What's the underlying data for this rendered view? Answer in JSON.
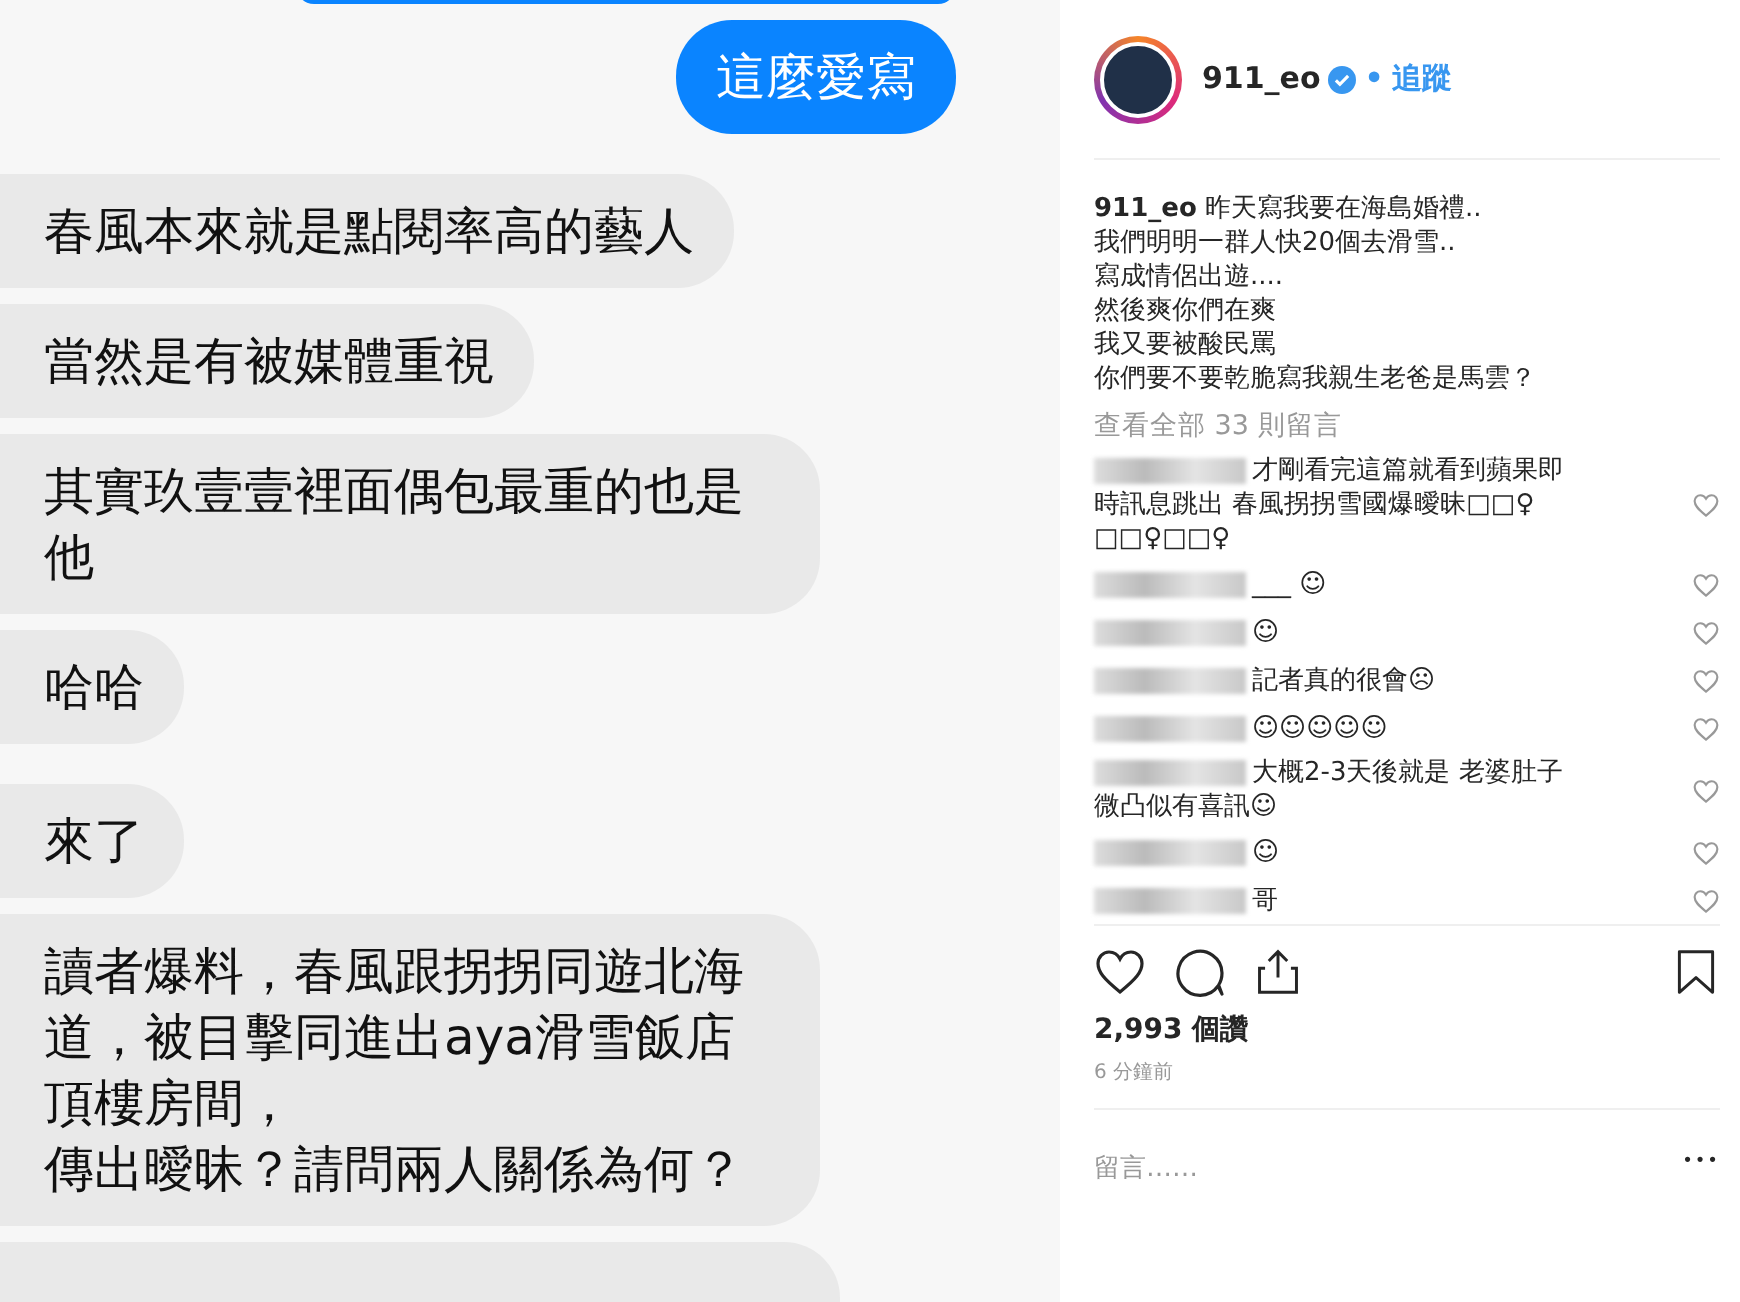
{
  "chat": {
    "messages": [
      {
        "kind": "sent",
        "text": "這麼愛寫"
      },
      {
        "kind": "received",
        "text": "春風本來就是點閱率高的藝人"
      },
      {
        "kind": "received",
        "text": "當然是有被媒體重視"
      },
      {
        "kind": "received",
        "text": "其實玖壹壹裡面偶包最重的也是他"
      },
      {
        "kind": "received",
        "text": "哈哈"
      },
      {
        "kind": "received",
        "text": "來了"
      },
      {
        "kind": "received",
        "text": "讀者爆料，春風跟拐拐同遊北海道，被目擊同進出aya滑雪飯店頂樓房間，",
        "text2": "傳出曖昧？請問兩人關係為何？"
      }
    ]
  },
  "post": {
    "username": "911_eo",
    "verified": true,
    "separator": "•",
    "follow": "追蹤",
    "caption_user": "911_eo",
    "caption": [
      "昨天寫我要在海島婚禮..",
      "我們明明一群人快20個去滑雪..",
      "寫成情侶出遊....",
      "然後爽你們在爽",
      "我又要被酸民罵",
      "你們要不要乾脆寫我親生老爸是馬雲？"
    ],
    "view_all": "查看全部 33 則留言",
    "comments": [
      {
        "text": "才剛看完這篇就看到蘋果即",
        "more_lines": [
          "時訊息跳出 春風拐拐雪國爆曖昧□□♀",
          "□□♀□□♀"
        ]
      },
      {
        "text": "___ ☺"
      },
      {
        "text": "☺"
      },
      {
        "text": "記者真的很會☹"
      },
      {
        "text": "☺☺☺☺☺"
      },
      {
        "text": "大概2-3天後就是 老婆肚子",
        "more_lines": [
          "微凸似有喜訊☺"
        ]
      },
      {
        "text": "☺"
      },
      {
        "text": "哥"
      }
    ],
    "likes": "2,993 個讚",
    "time": "6 分鐘前",
    "comment_placeholder": "留言……",
    "more": "•••"
  }
}
